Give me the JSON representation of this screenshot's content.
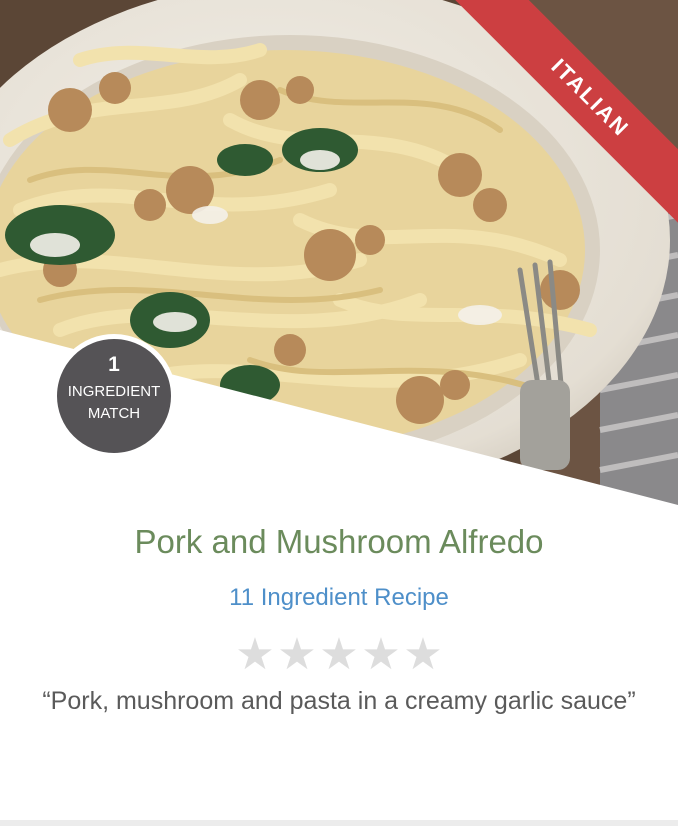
{
  "recipe_card": {
    "category_ribbon": "ITALIAN",
    "ingredient_match": {
      "count": "1",
      "label_line1": "INGREDIENT",
      "label_line2": "MATCH"
    },
    "title": "Pork and Mushroom Alfredo",
    "ingredient_count_text": "11 Ingredient Recipe",
    "rating": {
      "max": 5,
      "filled": 0,
      "star_glyph": "★"
    },
    "description": "“Pork, mushroom and pasta in a creamy garlic sauce”"
  },
  "colors": {
    "ribbon": "#cc3f41",
    "badge": "#555356",
    "title": "#6b8b5c",
    "link": "#4e8fc9",
    "star_empty": "#dddddd",
    "description": "#5a5a5a"
  }
}
